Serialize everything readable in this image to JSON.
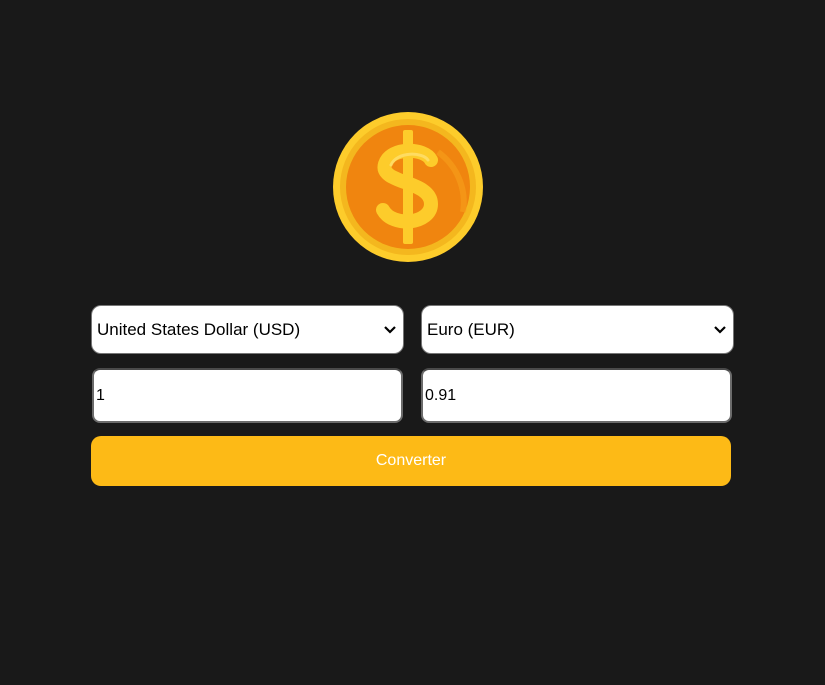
{
  "logo": {
    "icon": "dollar-coin-icon",
    "colors": {
      "rim": "#fdcc2b",
      "face": "#f0850f",
      "symbol": "#fdcc2b"
    }
  },
  "converter": {
    "from_currency": "United States Dollar (USD)",
    "to_currency": "Euro (EUR)",
    "from_amount": "1",
    "to_amount": "0.91",
    "convert_label": "Converter"
  },
  "colors": {
    "background": "#191919",
    "button": "#fdba16",
    "button_text": "#ffffff"
  }
}
